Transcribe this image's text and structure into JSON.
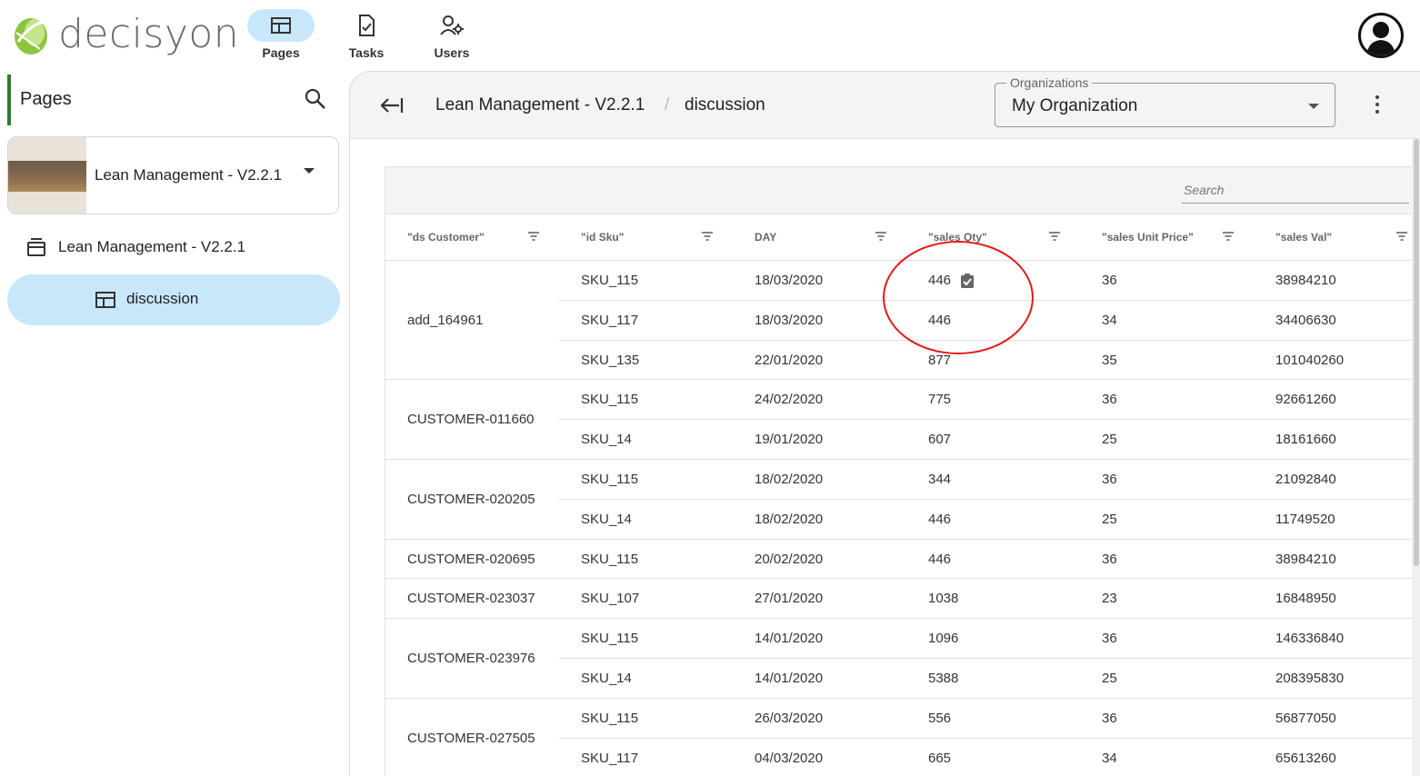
{
  "app": {
    "logo_text": "decisyon"
  },
  "topnav": [
    {
      "label": "Pages",
      "icon": "dashboard-icon",
      "active": true
    },
    {
      "label": "Tasks",
      "icon": "clipboard-check-icon",
      "active": false
    },
    {
      "label": "Users",
      "icon": "users-gear-icon",
      "active": false
    }
  ],
  "sidebar": {
    "title": "Pages",
    "app_card": {
      "name": "Lean Management - V2.2.1"
    },
    "tree": [
      {
        "label": "Lean Management - V2.2.1",
        "icon": "inbox-icon"
      },
      {
        "label": "discussion",
        "icon": "dashboard-icon",
        "selected": true
      }
    ]
  },
  "header": {
    "breadcrumb": [
      "Lean Management - V2.2.1",
      "discussion"
    ],
    "breadcrumb_sep": "/",
    "organizations": {
      "legend": "Organizations",
      "value": "My Organization"
    }
  },
  "grid": {
    "search_placeholder": "Search",
    "columns": [
      "\"ds Customer\"",
      "\"id Sku\"",
      "DAY",
      "\"sales Qty\"",
      "\"sales Unit Price\"",
      "\"sales Val\""
    ],
    "groups": [
      {
        "customer": "add_164961",
        "rows": [
          {
            "sku": "SKU_115",
            "day": "18/03/2020",
            "qty": "446",
            "price": "36",
            "val": "38984210",
            "has_note": true
          },
          {
            "sku": "SKU_117",
            "day": "18/03/2020",
            "qty": "446",
            "price": "34",
            "val": "34406630"
          },
          {
            "sku": "SKU_135",
            "day": "22/01/2020",
            "qty": "877",
            "price": "35",
            "val": "101040260"
          }
        ]
      },
      {
        "customer": "CUSTOMER-011660",
        "rows": [
          {
            "sku": "SKU_115",
            "day": "24/02/2020",
            "qty": "775",
            "price": "36",
            "val": "92661260"
          },
          {
            "sku": "SKU_14",
            "day": "19/01/2020",
            "qty": "607",
            "price": "25",
            "val": "18161660"
          }
        ]
      },
      {
        "customer": "CUSTOMER-020205",
        "rows": [
          {
            "sku": "SKU_115",
            "day": "18/02/2020",
            "qty": "344",
            "price": "36",
            "val": "21092840"
          },
          {
            "sku": "SKU_14",
            "day": "18/02/2020",
            "qty": "446",
            "price": "25",
            "val": "11749520"
          }
        ]
      },
      {
        "customer": "CUSTOMER-020695",
        "rows": [
          {
            "sku": "SKU_115",
            "day": "20/02/2020",
            "qty": "446",
            "price": "36",
            "val": "38984210"
          }
        ]
      },
      {
        "customer": "CUSTOMER-023037",
        "rows": [
          {
            "sku": "SKU_107",
            "day": "27/01/2020",
            "qty": "1038",
            "price": "23",
            "val": "16848950"
          }
        ]
      },
      {
        "customer": "CUSTOMER-023976",
        "rows": [
          {
            "sku": "SKU_115",
            "day": "14/01/2020",
            "qty": "1096",
            "price": "36",
            "val": "146336840"
          },
          {
            "sku": "SKU_14",
            "day": "14/01/2020",
            "qty": "5388",
            "price": "25",
            "val": "208395830"
          }
        ]
      },
      {
        "customer": "CUSTOMER-027505",
        "rows": [
          {
            "sku": "SKU_115",
            "day": "26/03/2020",
            "qty": "556",
            "price": "36",
            "val": "56877050"
          },
          {
            "sku": "SKU_117",
            "day": "04/03/2020",
            "qty": "665",
            "price": "34",
            "val": "65613260"
          }
        ]
      }
    ]
  },
  "colors": {
    "accent": "#c9e7fb",
    "sidebar_marker": "#2e7d32",
    "highlight": "#e31b1b",
    "logo_green": "#8cc63f"
  }
}
